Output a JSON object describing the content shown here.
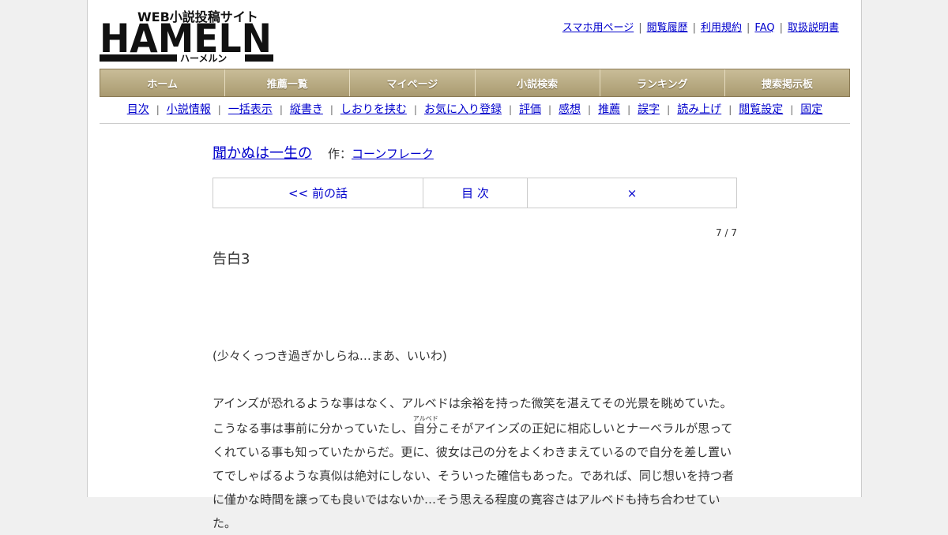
{
  "header": {
    "logo": {
      "tagline": "WEB小説投稿サイト",
      "wordmark": "HAMELN",
      "kana": "ハーメルン"
    },
    "top_links": [
      "スマホ用ページ",
      "閲覧履歴",
      "利用規約",
      "FAQ",
      "取扱説明書"
    ]
  },
  "global_nav": [
    "ホーム",
    "推薦一覧",
    "マイページ",
    "小説検索",
    "ランキング",
    "捜索掲示板"
  ],
  "sub_nav": [
    "目次",
    "小説情報",
    "一括表示",
    "縦書き",
    "しおりを挟む",
    "お気に入り登録",
    "評価",
    "感想",
    "推薦",
    "誤字",
    "読み上げ",
    "閲覧設定",
    "固定"
  ],
  "novel": {
    "title": "聞かぬは一生の",
    "author_label": "作：",
    "author": "コーンフレーク"
  },
  "pager": {
    "prev": "<< 前の話",
    "toc": "目 次",
    "next": "×"
  },
  "episode": {
    "counter": "7 / 7",
    "subtitle": "告白3"
  },
  "body": {
    "p1": "(少々くっつき過ぎかしらね…まあ、いいわ)",
    "l1": "アインズが恐れるような事はなく、アルベドは余裕を持った微笑を湛えてその光景を眺めていた。",
    "l2_before": "こうなる事は事前に分かっていたし、",
    "l2_ruby_base": "自分",
    "l2_ruby_text": "アルベド",
    "l2_after": "こそがアインズの正妃に相応しいとナーベラルが思って",
    "l3": "くれている事も知っていたからだ。更に、彼女は己の分をよくわきまえているので自分を差し置い",
    "l4": "てでしゃばるような真似は絶対にしない、そういった確信もあった。であれば、同じ想いを持つ者",
    "l5": "に僅かな時間を譲っても良いではないか…そう思える程度の寛容さはアルベドも持ち合わせていた。"
  }
}
